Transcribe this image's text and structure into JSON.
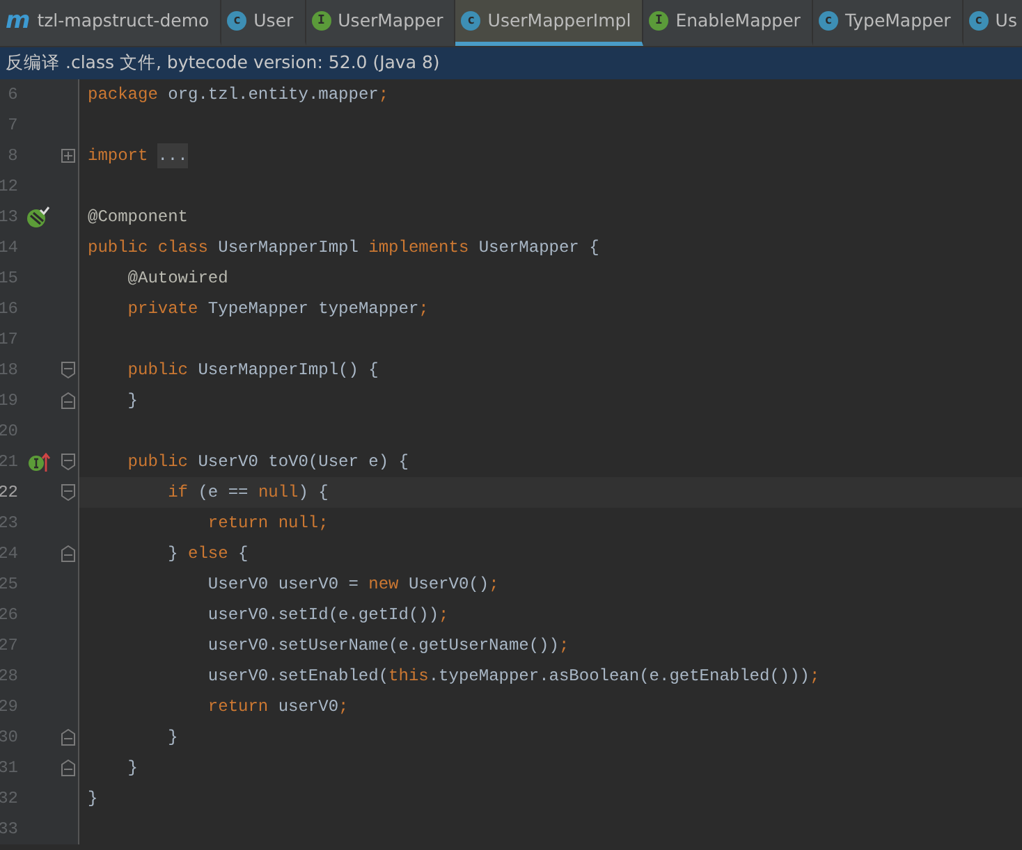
{
  "tabs": [
    {
      "label": "tzl-mapstruct-demo",
      "icon": "m",
      "kind": "project",
      "selected": false
    },
    {
      "label": "User",
      "icon": "c",
      "kind": "class",
      "selected": false
    },
    {
      "label": "UserMapper",
      "icon": "I",
      "kind": "interface",
      "selected": false
    },
    {
      "label": "UserMapperImpl",
      "icon": "c",
      "kind": "class",
      "selected": true
    },
    {
      "label": "EnableMapper",
      "icon": "I",
      "kind": "interface",
      "selected": false
    },
    {
      "label": "TypeMapper",
      "icon": "c",
      "kind": "class",
      "selected": false
    },
    {
      "label": "Us",
      "icon": "c",
      "kind": "class",
      "selected": false
    }
  ],
  "banner": "反编译 .class 文件, bytecode version: 52.0 (Java 8)",
  "lines": [
    {
      "number": "6",
      "current": false,
      "tokens": [
        {
          "kind": "kw",
          "text": "package"
        },
        {
          "kind": "plain",
          "text": " org.tzl.entity.mapper"
        },
        {
          "kind": "kw",
          "text": ";"
        }
      ]
    },
    {
      "number": "7",
      "current": false
    },
    {
      "number": "8",
      "current": false,
      "fold": {
        "kind": "collapsed"
      },
      "tokens": [
        {
          "kind": "kw",
          "text": "import"
        },
        {
          "kind": "folded",
          "text": "..."
        }
      ]
    },
    {
      "number": "12",
      "current": false
    },
    {
      "number": "13",
      "current": false,
      "marker": {
        "kind": "bean"
      },
      "tokens": [
        {
          "kind": "annotation",
          "text": "@Component"
        }
      ]
    },
    {
      "number": "14",
      "current": false,
      "tokens": [
        {
          "kind": "kw",
          "text": "public class"
        },
        {
          "kind": "plain",
          "text": " UserMapperImpl "
        },
        {
          "kind": "kw",
          "text": "implements"
        },
        {
          "kind": "plain",
          "text": " UserMapper {"
        }
      ]
    },
    {
      "number": "15",
      "current": false,
      "tokens": [
        {
          "kind": "annotation",
          "text": "    @Autowired"
        }
      ]
    },
    {
      "number": "16",
      "current": false,
      "tokens": [
        {
          "kind": "kw",
          "text": "    private"
        },
        {
          "kind": "plain",
          "text": " TypeMapper typeMapper"
        },
        {
          "kind": "kw",
          "text": ";"
        }
      ]
    },
    {
      "number": "17",
      "current": false
    },
    {
      "number": "18",
      "current": false,
      "fold": {
        "kind": "start"
      },
      "tokens": [
        {
          "kind": "kw",
          "text": "    public"
        },
        {
          "kind": "plain",
          "text": " UserMapperImpl() {"
        }
      ]
    },
    {
      "number": "19",
      "current": false,
      "fold": {
        "kind": "end"
      },
      "tokens": [
        {
          "kind": "plain",
          "text": "    }"
        }
      ]
    },
    {
      "number": "20",
      "current": false
    },
    {
      "number": "21",
      "current": false,
      "marker": {
        "kind": "implements"
      },
      "fold": {
        "kind": "start"
      },
      "tokens": [
        {
          "kind": "kw",
          "text": "    public"
        },
        {
          "kind": "plain",
          "text": " UserV0 toV0(User e) {"
        }
      ]
    },
    {
      "number": "22",
      "current": true,
      "fold": {
        "kind": "start"
      },
      "tokens": [
        {
          "kind": "kw",
          "text": "        if"
        },
        {
          "kind": "plain",
          "text": " (e == "
        },
        {
          "kind": "kw",
          "text": "null"
        },
        {
          "kind": "plain",
          "text": ") {"
        }
      ]
    },
    {
      "number": "23",
      "current": false,
      "tokens": [
        {
          "kind": "kw",
          "text": "            return null;"
        }
      ]
    },
    {
      "number": "24",
      "current": false,
      "fold": {
        "kind": "end"
      },
      "tokens": [
        {
          "kind": "plain",
          "text": "        } "
        },
        {
          "kind": "kw",
          "text": "else"
        },
        {
          "kind": "plain",
          "text": " {"
        }
      ]
    },
    {
      "number": "25",
      "current": false,
      "tokens": [
        {
          "kind": "plain",
          "text": "            UserV0 userV0 = "
        },
        {
          "kind": "kw",
          "text": "new"
        },
        {
          "kind": "plain",
          "text": " UserV0()"
        },
        {
          "kind": "kw",
          "text": ";"
        }
      ]
    },
    {
      "number": "26",
      "current": false,
      "tokens": [
        {
          "kind": "plain",
          "text": "            userV0.setId(e.getId())"
        },
        {
          "kind": "kw",
          "text": ";"
        }
      ]
    },
    {
      "number": "27",
      "current": false,
      "tokens": [
        {
          "kind": "plain",
          "text": "            userV0.setUserName(e.getUserName())"
        },
        {
          "kind": "kw",
          "text": ";"
        }
      ]
    },
    {
      "number": "28",
      "current": false,
      "tokens": [
        {
          "kind": "plain",
          "text": "            userV0.setEnabled("
        },
        {
          "kind": "kw",
          "text": "this"
        },
        {
          "kind": "plain",
          "text": ".typeMapper.asBoolean(e.getEnabled()))"
        },
        {
          "kind": "kw",
          "text": ";"
        }
      ]
    },
    {
      "number": "29",
      "current": false,
      "tokens": [
        {
          "kind": "kw",
          "text": "            return"
        },
        {
          "kind": "plain",
          "text": " userV0"
        },
        {
          "kind": "kw",
          "text": ";"
        }
      ]
    },
    {
      "number": "30",
      "current": false,
      "fold": {
        "kind": "end"
      },
      "tokens": [
        {
          "kind": "plain",
          "text": "        }"
        }
      ]
    },
    {
      "number": "31",
      "current": false,
      "fold": {
        "kind": "end"
      },
      "tokens": [
        {
          "kind": "plain",
          "text": "    }"
        }
      ]
    },
    {
      "number": "32",
      "current": false,
      "tokens": [
        {
          "kind": "plain",
          "text": "}"
        }
      ]
    },
    {
      "number": "33",
      "current": false
    }
  ]
}
